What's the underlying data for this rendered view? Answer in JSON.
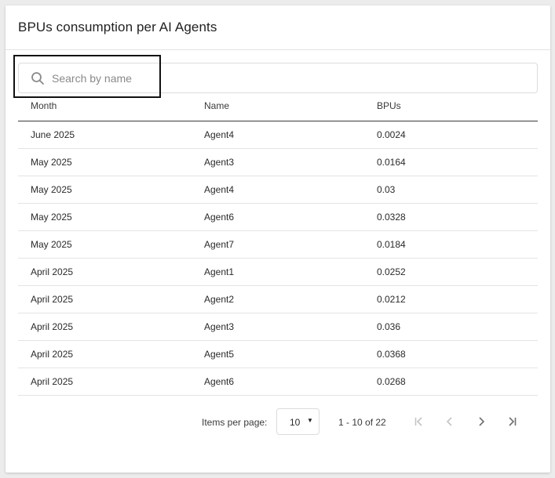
{
  "card": {
    "title": "BPUs consumption per AI Agents"
  },
  "search": {
    "placeholder": "Search by name",
    "value": "",
    "icon": "search-icon"
  },
  "table": {
    "columns": [
      "Month",
      "Name",
      "BPUs"
    ],
    "rows": [
      [
        "June 2025",
        "Agent4",
        "0.0024"
      ],
      [
        "May 2025",
        "Agent3",
        "0.0164"
      ],
      [
        "May 2025",
        "Agent4",
        "0.03"
      ],
      [
        "May 2025",
        "Agent6",
        "0.0328"
      ],
      [
        "May 2025",
        "Agent7",
        "0.0184"
      ],
      [
        "April 2025",
        "Agent1",
        "0.0252"
      ],
      [
        "April 2025",
        "Agent2",
        "0.0212"
      ],
      [
        "April 2025",
        "Agent3",
        "0.036"
      ],
      [
        "April 2025",
        "Agent5",
        "0.0368"
      ],
      [
        "April 2025",
        "Agent6",
        "0.0268"
      ]
    ]
  },
  "paginator": {
    "items_per_page_label": "Items per page:",
    "items_per_page_value": "10",
    "range_label": "1 - 10 of 22",
    "first_enabled": false,
    "prev_enabled": false,
    "next_enabled": true,
    "last_enabled": true
  },
  "colors": {
    "enabled_icon": "#6e6e6e",
    "disabled_icon": "#c4c4c4"
  }
}
